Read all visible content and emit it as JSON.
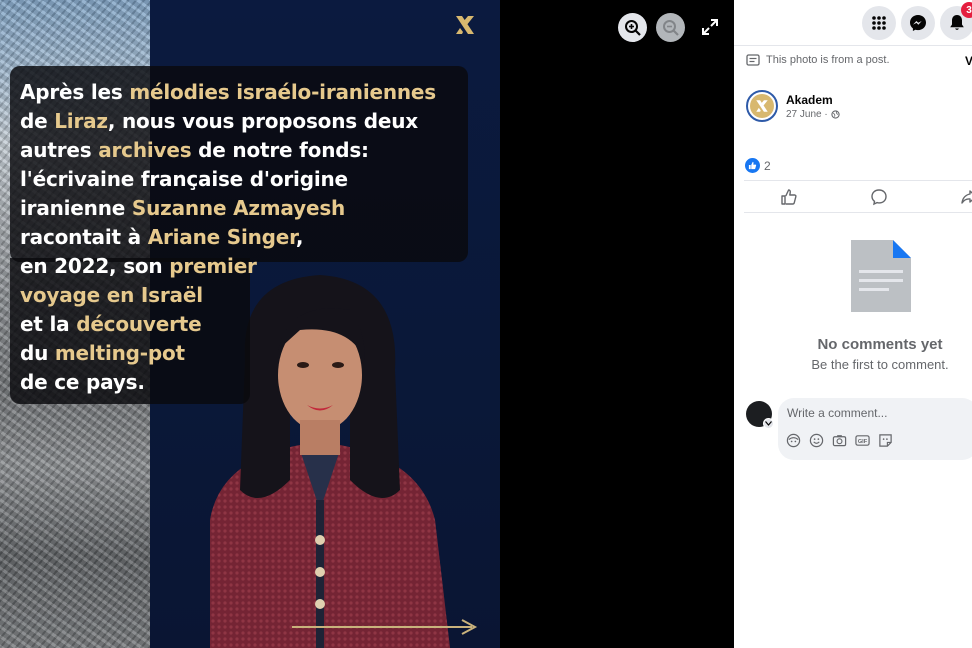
{
  "photo": {
    "caption_lines": [
      [
        {
          "t": "Après les ",
          "hl": false
        },
        {
          "t": "mélodies israélo-iraniennes",
          "hl": true
        }
      ],
      [
        {
          "t": "de ",
          "hl": false
        },
        {
          "t": "Liraz",
          "hl": true
        },
        {
          "t": ", nous vous proposons deux",
          "hl": false
        }
      ],
      [
        {
          "t": "autres ",
          "hl": false
        },
        {
          "t": "archives",
          "hl": true
        },
        {
          "t": " de notre fonds:",
          "hl": false
        }
      ],
      [
        {
          "t": "l'écrivaine française d'origine",
          "hl": false
        }
      ],
      [
        {
          "t": "iranienne ",
          "hl": false
        },
        {
          "t": "Suzanne Azmayesh",
          "hl": true
        }
      ],
      [
        {
          "t": "racontait à ",
          "hl": false
        },
        {
          "t": "Ariane Singer",
          "hl": true
        },
        {
          "t": ",",
          "hl": false
        }
      ],
      [
        {
          "t": "en 2022, son ",
          "hl": false
        },
        {
          "t": "premier",
          "hl": true
        }
      ],
      [
        {
          "t": "voyage en Israël",
          "hl": true
        }
      ],
      [
        {
          "t": "et la ",
          "hl": false
        },
        {
          "t": "découverte",
          "hl": true
        }
      ],
      [
        {
          "t": "du ",
          "hl": false
        },
        {
          "t": "melting-pot",
          "hl": true
        }
      ],
      [
        {
          "t": "de ce pays.",
          "hl": false
        }
      ]
    ],
    "highlight_color": "#e6c98d"
  },
  "viewer_controls": {
    "zoom_in": "zoom-in-icon",
    "zoom_out": "zoom-out-icon",
    "fullscreen": "expand-icon"
  },
  "topbar": {
    "menu_icon": "grid-menu-icon",
    "messenger_icon": "messenger-icon",
    "notifications_icon": "bell-icon",
    "notification_count": "3"
  },
  "post": {
    "note": "This photo is from a post.",
    "view_label": "V",
    "author": "Akadem",
    "date": "27 June ·",
    "reaction_count": "2"
  },
  "comments": {
    "empty_title": "No comments yet",
    "empty_subtitle": "Be the first to comment.",
    "placeholder": "Write a comment..."
  }
}
